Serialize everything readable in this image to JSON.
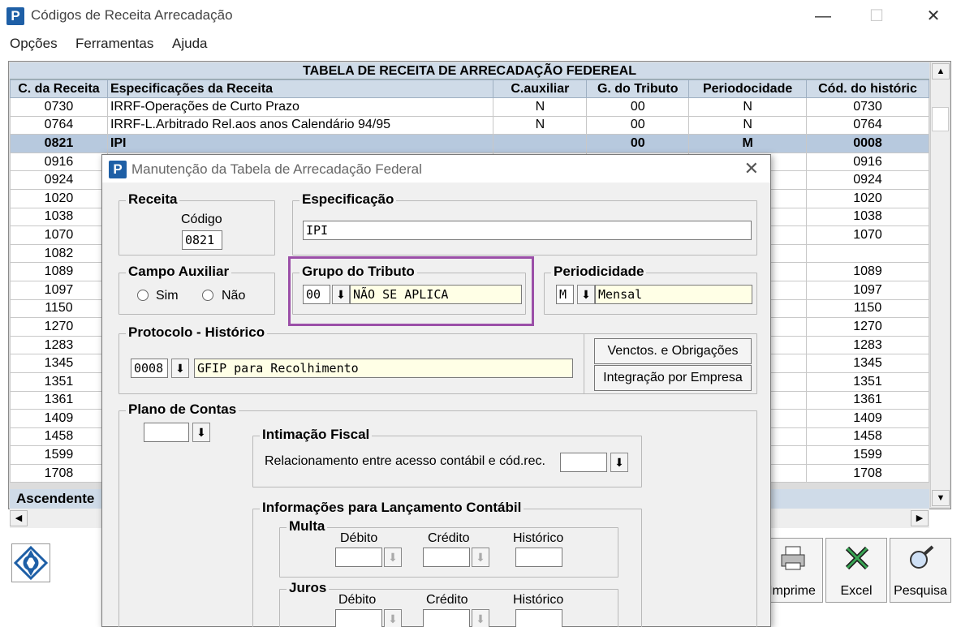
{
  "window": {
    "title": "Códigos de Receita Arrecadação",
    "app_icon": "P"
  },
  "menu": [
    "Opções",
    "Ferramentas",
    "Ajuda"
  ],
  "grid": {
    "title": "TABELA DE RECEITA DE ARRECADAÇÃO FEDEREAL",
    "columns": [
      "C. da Receita",
      "Especificações da Receita",
      "C.auxiliar",
      "G. do Tributo",
      "Periodocidade",
      "Cód. do históric"
    ],
    "rows": [
      [
        "0730",
        "IRRF-Operações de Curto Prazo",
        "N",
        "00",
        "N",
        "0730"
      ],
      [
        "0764",
        "IRRF-L.Arbitrado Rel.aos anos Calendário 94/95",
        "N",
        "00",
        "N",
        "0764"
      ],
      [
        "0821",
        "IPI",
        "",
        "00",
        "M",
        "0008"
      ],
      [
        "0916",
        "",
        "",
        "",
        "",
        "0916"
      ],
      [
        "0924",
        "",
        "",
        "",
        "",
        "0924"
      ],
      [
        "1020",
        "",
        "",
        "",
        "",
        "1020"
      ],
      [
        "1038",
        "",
        "",
        "",
        "",
        "1038"
      ],
      [
        "1070",
        "",
        "",
        "",
        "",
        "1070"
      ],
      [
        "1082",
        "",
        "",
        "",
        "",
        ""
      ],
      [
        "1089",
        "",
        "",
        "",
        "",
        "1089"
      ],
      [
        "1097",
        "",
        "",
        "",
        "",
        "1097"
      ],
      [
        "1150",
        "",
        "",
        "",
        "",
        "1150"
      ],
      [
        "1270",
        "",
        "",
        "",
        "",
        "1270"
      ],
      [
        "1283",
        "",
        "",
        "",
        "",
        "1283"
      ],
      [
        "1345",
        "",
        "",
        "",
        "",
        "1345"
      ],
      [
        "1351",
        "",
        "",
        "",
        "",
        "1351"
      ],
      [
        "1361",
        "",
        "",
        "",
        "",
        "1361"
      ],
      [
        "1409",
        "",
        "",
        "",
        "",
        "1409"
      ],
      [
        "1458",
        "",
        "",
        "",
        "",
        "1458"
      ],
      [
        "1599",
        "",
        "",
        "",
        "",
        "1599"
      ],
      [
        "1708",
        "",
        "",
        "",
        "",
        "1708"
      ]
    ],
    "selected_row": 2,
    "status": "Ascendente"
  },
  "toolbar": {
    "imprime": "Imprime",
    "excel": "Excel",
    "pesquisa": "Pesquisa"
  },
  "dialog": {
    "title": "Manutenção da Tabela de Arrecadação Federal",
    "receita": {
      "legend": "Receita",
      "codigo_label": "Código",
      "codigo": "0821"
    },
    "especificacao": {
      "legend": "Especificação",
      "value": "IPI"
    },
    "campo_auxiliar": {
      "legend": "Campo Auxiliar",
      "sim": "Sim",
      "nao": "Não"
    },
    "grupo_tributo": {
      "legend": "Grupo do Tributo",
      "code": "00",
      "desc": "NÃO SE APLICA",
      "highlight_color": "#9b4fa8"
    },
    "periodicidade": {
      "legend": "Periodicidade",
      "code": "M",
      "desc": "Mensal"
    },
    "protocolo": {
      "legend": "Protocolo - Histórico",
      "code": "0008",
      "desc": "GFIP para Recolhimento"
    },
    "buttons": {
      "venctos": "Venctos. e Obrigações",
      "integracao": "Integração por Empresa"
    },
    "plano_contas": {
      "legend": "Plano de Contas"
    },
    "intimacao": {
      "legend": "Intimação Fiscal",
      "label": "Relacionamento entre acesso contábil e cód.rec."
    },
    "lancamento": {
      "legend": "Informações para Lançamento Contábil",
      "multa": {
        "legend": "Multa",
        "debito": "Débito",
        "credito": "Crédito",
        "historico": "Histórico"
      },
      "juros": {
        "legend": "Juros",
        "debito": "Débito",
        "credito": "Crédito",
        "historico": "Histórico"
      }
    }
  }
}
